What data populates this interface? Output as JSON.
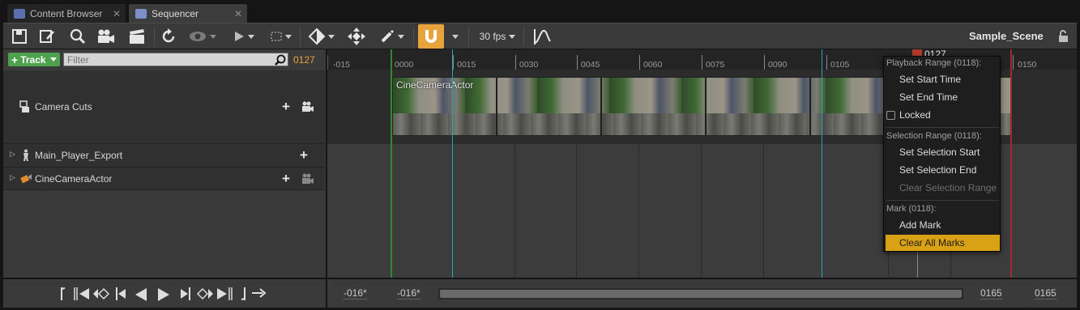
{
  "tabs": [
    {
      "label": "Content Browser"
    },
    {
      "label": "Sequencer"
    }
  ],
  "toolbar": {
    "fps_label": "30 fps",
    "scene_name": "Sample_Scene"
  },
  "track_panel": {
    "add_track_label": "Track",
    "filter_placeholder": "Filter",
    "current_frame": "0127"
  },
  "tracks": [
    {
      "label": "Camera Cuts"
    },
    {
      "label": "Main_Player_Export"
    },
    {
      "label": "CineCameraActor"
    }
  ],
  "timeline": {
    "playhead_frame": "0127",
    "ruler_labels": [
      "-015",
      "0000",
      "0015",
      "0030",
      "0045",
      "0060",
      "0075",
      "0090",
      "0105",
      "0150"
    ],
    "section_label": "CineCameraActor"
  },
  "context_menu": {
    "playback_header": "Playback Range (0118):",
    "set_start": "Set Start Time",
    "set_end": "Set End Time",
    "locked": "Locked",
    "selection_header": "Selection Range (0118):",
    "set_sel_start": "Set Selection Start",
    "set_sel_end": "Set Selection End",
    "clear_sel": "Clear Selection Range",
    "mark_header": "Mark (0118):",
    "add_mark": "Add Mark",
    "clear_marks": "Clear All Marks"
  },
  "bottom": {
    "range_start": "-016*",
    "view_start": "-016*",
    "view_end": "0165",
    "range_end": "0165"
  },
  "colors": {
    "accent_orange": "#e8a33c",
    "highlight": "#d9a214",
    "green_button": "#4ea24e",
    "playhead_red": "#b03a2e"
  }
}
